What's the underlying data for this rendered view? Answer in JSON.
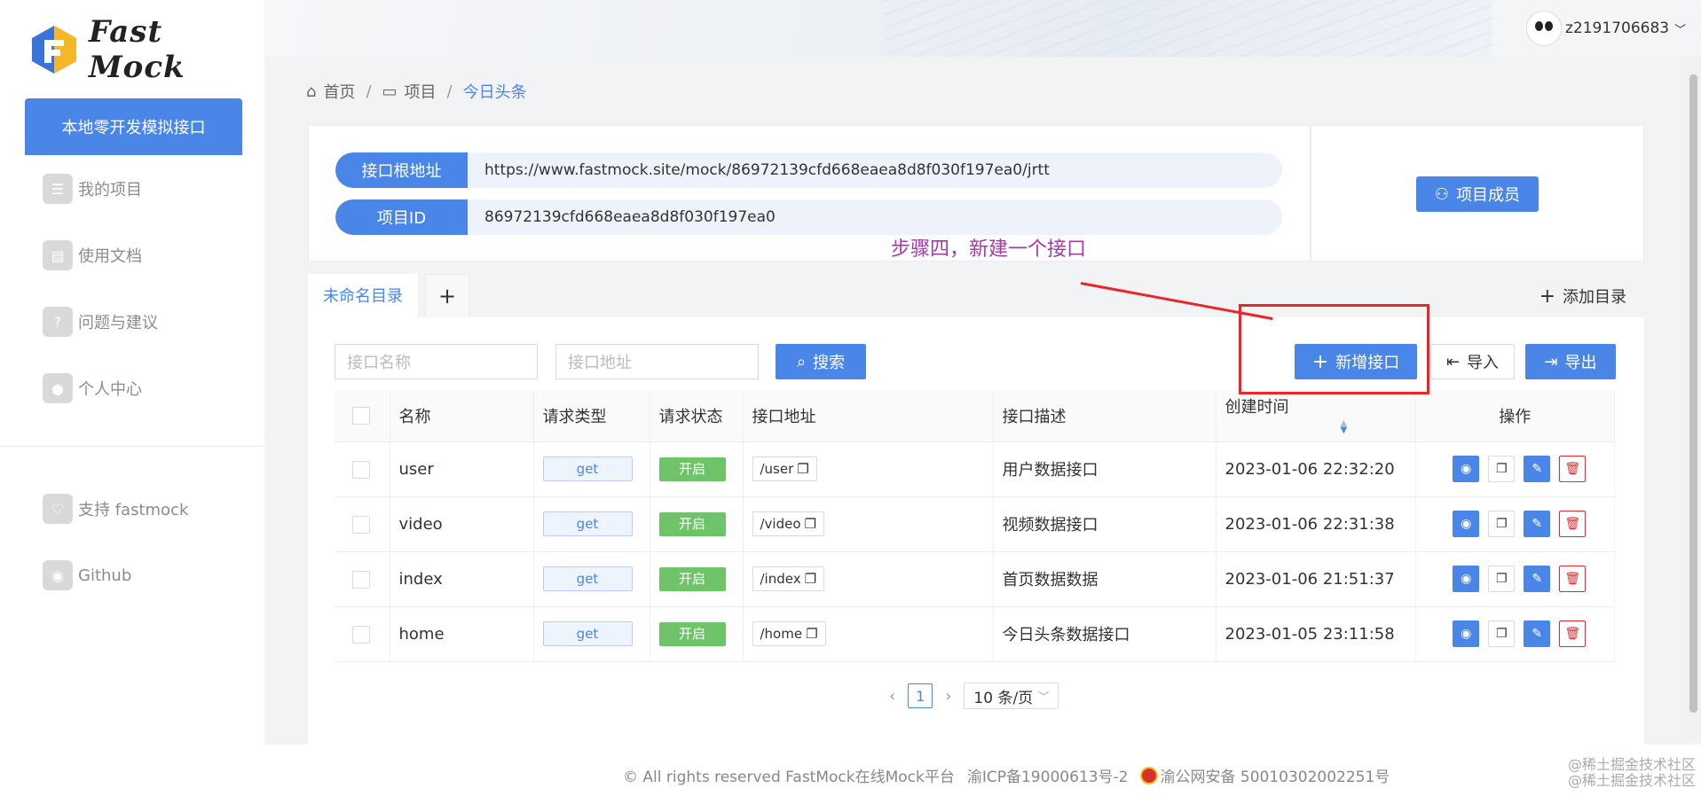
{
  "brand": {
    "name": "Fast Mock"
  },
  "sidebar": {
    "primary_button": "本地零开发模拟接口",
    "items": [
      {
        "label": "我的项目",
        "icon": "list-icon"
      },
      {
        "label": "使用文档",
        "icon": "document-icon"
      },
      {
        "label": "问题与建议",
        "icon": "question-icon"
      },
      {
        "label": "个人中心",
        "icon": "user-icon"
      }
    ],
    "bottom_items": [
      {
        "label": "支持 fastmock",
        "icon": "heart-icon"
      },
      {
        "label": "Github",
        "icon": "github-icon"
      }
    ]
  },
  "header": {
    "username": "z2191706683"
  },
  "breadcrumb": {
    "home": "首页",
    "project": "项目",
    "current": "今日头条"
  },
  "info": {
    "root_label": "接口根地址",
    "root_value": "https://www.fastmock.site/mock/86972139cfd668eaea8d8f030f197ea0/jrtt",
    "id_label": "项目ID",
    "id_value": "86972139cfd668eaea8d8f030f197ea0",
    "members_button": "项目成员"
  },
  "annotation": {
    "text": "步骤四，新建一个接口"
  },
  "tabs": {
    "active": "未命名目录",
    "add": "+",
    "add_dir": "添加目录"
  },
  "toolbar": {
    "name_placeholder": "接口名称",
    "url_placeholder": "接口地址",
    "search": "搜索",
    "new_api": "新增接口",
    "import": "导入",
    "export": "导出"
  },
  "table": {
    "headers": [
      "名称",
      "请求类型",
      "请求状态",
      "接口地址",
      "接口描述",
      "创建时间",
      "操作"
    ],
    "rows": [
      {
        "name": "user",
        "method": "get",
        "status": "开启",
        "url": "/user",
        "desc": "用户数据接口",
        "created": "2023-01-06 22:32:20"
      },
      {
        "name": "video",
        "method": "get",
        "status": "开启",
        "url": "/video",
        "desc": "视频数据接口",
        "created": "2023-01-06 22:31:38"
      },
      {
        "name": "index",
        "method": "get",
        "status": "开启",
        "url": "/index",
        "desc": "首页数据数据",
        "created": "2023-01-06 21:51:37"
      },
      {
        "name": "home",
        "method": "get",
        "status": "开启",
        "url": "/home",
        "desc": "今日头条数据接口",
        "created": "2023-01-05 23:11:58"
      }
    ]
  },
  "pagination": {
    "current": "1",
    "page_size": "10 条/页"
  },
  "footer": {
    "copyright": "© All rights reserved FastMock在线Mock平台",
    "icp": "渝ICP备19000613号-2",
    "police": "渝公网安备 50010302002251号"
  },
  "watermark": {
    "line1": "@稀土掘金技术社区",
    "line2": "@稀土掘金技术社区"
  },
  "colors": {
    "primary": "#4a86e8",
    "success": "#6fc46a",
    "danger": "#e8262c",
    "annotation": "#a23ba5"
  }
}
